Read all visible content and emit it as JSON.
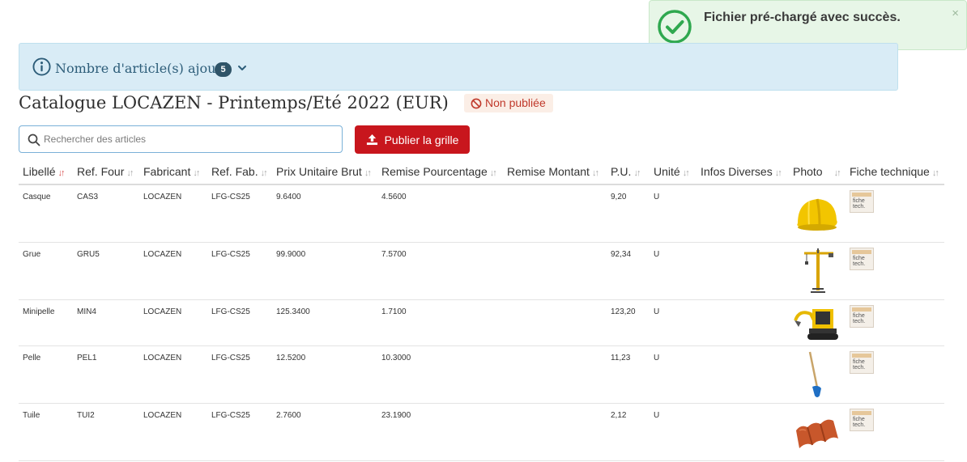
{
  "toast": {
    "message": "Fichier pré-chargé avec succès.",
    "close": "×",
    "icon": "check-circle-icon"
  },
  "alert": {
    "label": "Nombre d'article(s) ajouté",
    "count": "5",
    "icon": "info-icon"
  },
  "catalog": {
    "title": "Catalogue LOCAZEN - Printemps/Eté 2022 (EUR)",
    "status": "Non publiée"
  },
  "search": {
    "placeholder": "Rechercher des articles"
  },
  "publish": {
    "label": "Publier la grille",
    "icon": "upload-icon"
  },
  "columns": [
    "Libellé",
    "Ref. Four",
    "Fabricant",
    "Ref. Fab.",
    "Prix Unitaire Brut",
    "Remise Pourcentage",
    "Remise Montant",
    "P.U.",
    "Unité",
    "Infos Diverses",
    "Photo",
    "Fiche technique"
  ],
  "rows": [
    {
      "libelle": "Casque",
      "ref_four": "CAS3",
      "fabricant": "LOCAZEN",
      "ref_fab": "LFG-CS25",
      "prix_brut": "9.6400",
      "remise_pct": "4.5600",
      "remise_montant": "",
      "pu": "9,20",
      "unite": "U",
      "infos": "",
      "photo": "helmet"
    },
    {
      "libelle": "Grue",
      "ref_four": "GRU5",
      "fabricant": "LOCAZEN",
      "ref_fab": "LFG-CS25",
      "prix_brut": "99.9000",
      "remise_pct": "7.5700",
      "remise_montant": "",
      "pu": "92,34",
      "unite": "U",
      "infos": "",
      "photo": "crane"
    },
    {
      "libelle": "Minipelle",
      "ref_four": "MIN4",
      "fabricant": "LOCAZEN",
      "ref_fab": "LFG-CS25",
      "prix_brut": "125.3400",
      "remise_pct": "1.7100",
      "remise_montant": "",
      "pu": "123,20",
      "unite": "U",
      "infos": "",
      "photo": "excavator"
    },
    {
      "libelle": "Pelle",
      "ref_four": "PEL1",
      "fabricant": "LOCAZEN",
      "ref_fab": "LFG-CS25",
      "prix_brut": "12.5200",
      "remise_pct": "10.3000",
      "remise_montant": "",
      "pu": "11,23",
      "unite": "U",
      "infos": "",
      "photo": "shovel"
    },
    {
      "libelle": "Tuile",
      "ref_four": "TUI2",
      "fabricant": "LOCAZEN",
      "ref_fab": "LFG-CS25",
      "prix_brut": "2.7600",
      "remise_pct": "23.1900",
      "remise_montant": "",
      "pu": "2,12",
      "unite": "U",
      "infos": "",
      "photo": "roof-tile"
    }
  ],
  "colors": {
    "accent": "#c8161d",
    "info_bg": "#d9ecf6",
    "success_bg": "#e7f6e7",
    "success_icon": "#2fa84f"
  }
}
